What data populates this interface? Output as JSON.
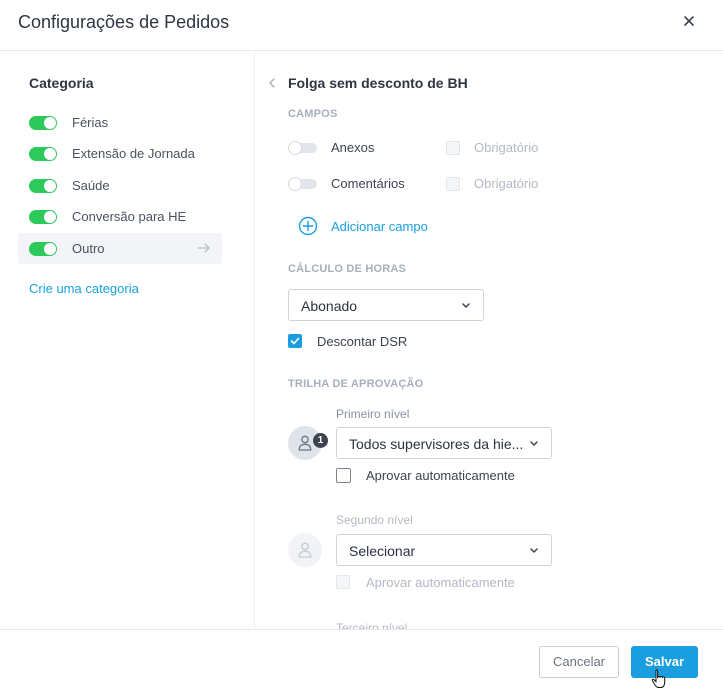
{
  "dialog": {
    "title": "Configurações de Pedidos",
    "close_icon": "close-icon"
  },
  "sidebar": {
    "title": "Categoria",
    "items": [
      {
        "label": "Férias",
        "enabled": true
      },
      {
        "label": "Extensão de Jornada",
        "enabled": true
      },
      {
        "label": "Saúde",
        "enabled": true
      },
      {
        "label": "Conversão para HE",
        "enabled": true
      },
      {
        "label": "Outro",
        "enabled": true,
        "selected": true
      }
    ],
    "create_link": "Crie uma categoria"
  },
  "main": {
    "title": "Folga sem desconto de BH",
    "sections": {
      "fields": "CAMPOS",
      "hours": "CÁLCULO DE HORAS",
      "approval": "TRILHA DE APROVAÇÃO"
    },
    "fields": [
      {
        "label": "Anexos",
        "enabled": false,
        "required_label": "Obrigatório",
        "required": false
      },
      {
        "label": "Comentários",
        "enabled": false,
        "required_label": "Obrigatório",
        "required": false
      }
    ],
    "add_field": "Adicionar campo",
    "hours_select": "Abonado",
    "discount_dsr": {
      "label": "Descontar DSR",
      "checked": true
    },
    "levels": [
      {
        "label": "Primeiro nível",
        "badge": "1",
        "select": "Todos supervisores da hie...",
        "auto_label": "Aprovar automaticamente",
        "auto_checked": false,
        "disabled": false
      },
      {
        "label": "Segundo nível",
        "select": "Selecionar",
        "auto_label": "Aprovar automaticamente",
        "auto_checked": false,
        "disabled": true
      }
    ],
    "partial_text": "Terceiro nível"
  },
  "footer": {
    "cancel": "Cancelar",
    "save": "Salvar"
  },
  "colors": {
    "accent": "#1a9ee0",
    "toggle_on": "#2ec95b",
    "text": "#2b3340"
  }
}
